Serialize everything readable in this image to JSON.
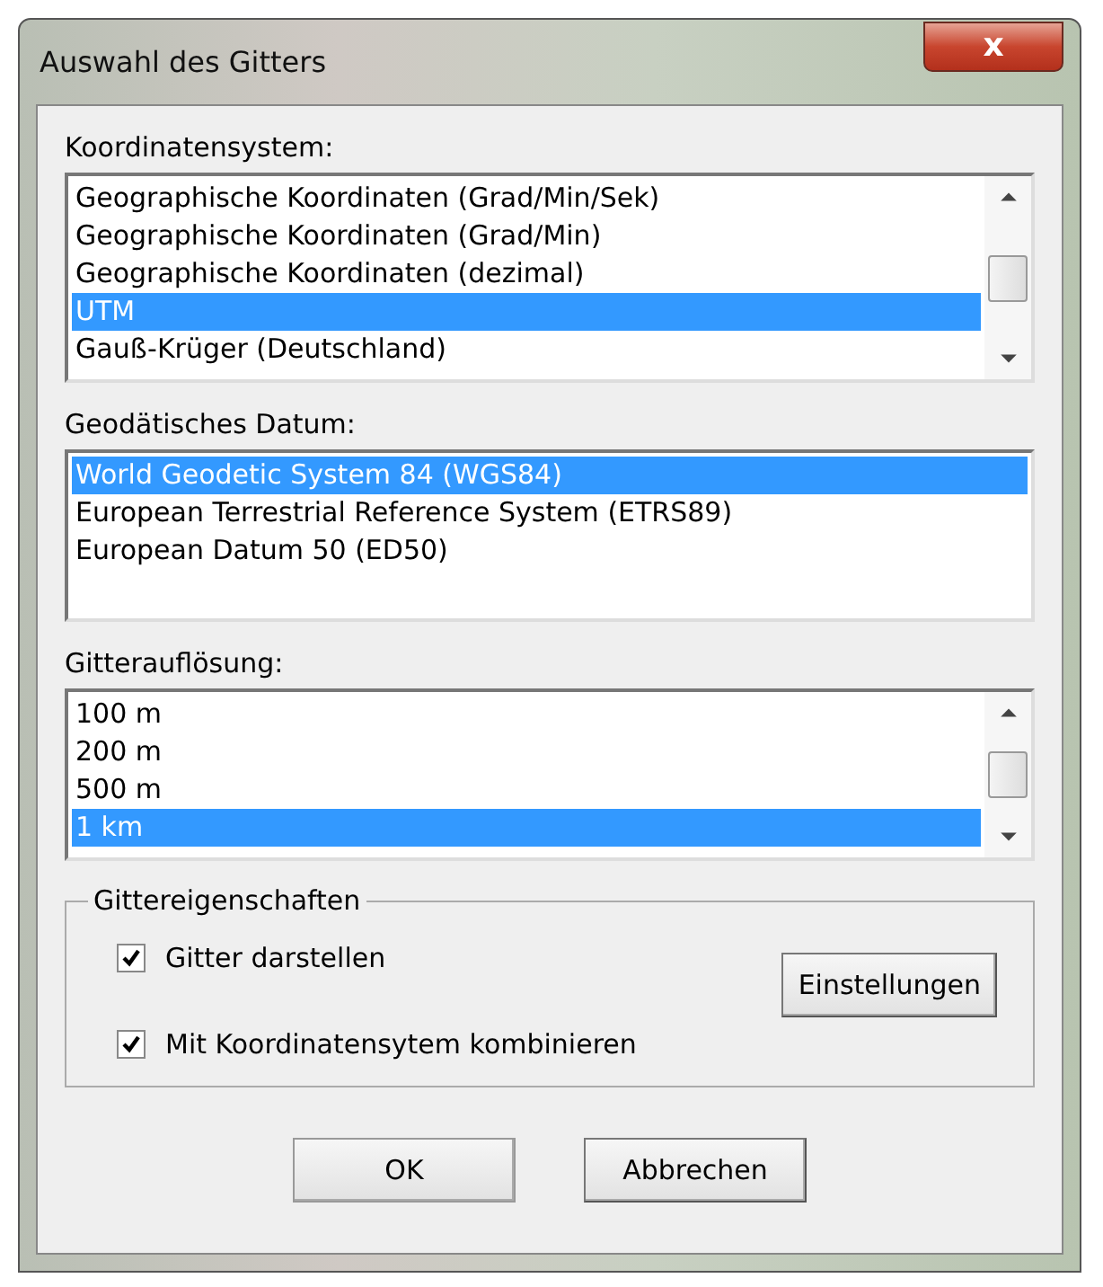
{
  "window": {
    "title": "Auswahl des Gitters",
    "close_label": "x"
  },
  "lists": [
    {
      "label": "Koordinatensystem:",
      "scrollbar": true,
      "items": [
        {
          "text": "Geographische Koordinaten (Grad/Min/Sek)",
          "selected": false
        },
        {
          "text": "Geographische Koordinaten (Grad/Min)",
          "selected": false
        },
        {
          "text": "Geographische Koordinaten (dezimal)",
          "selected": false
        },
        {
          "text": "UTM",
          "selected": true
        },
        {
          "text": "Gauß-Krüger (Deutschland)",
          "selected": false
        }
      ]
    },
    {
      "label": "Geodätisches Datum:",
      "scrollbar": false,
      "items": [
        {
          "text": "World Geodetic System 84 (WGS84)",
          "selected": true
        },
        {
          "text": "European Terrestrial Reference System (ETRS89)",
          "selected": false
        },
        {
          "text": "European Datum 50 (ED50)",
          "selected": false
        }
      ]
    },
    {
      "label": "Gitterauflösung:",
      "scrollbar": true,
      "items": [
        {
          "text": "100 m",
          "selected": false
        },
        {
          "text": "200 m",
          "selected": false
        },
        {
          "text": "500 m",
          "selected": false
        },
        {
          "text": "1 km",
          "selected": true
        }
      ]
    }
  ],
  "group": {
    "title": "Gittereigenschaften",
    "checkboxes": [
      {
        "label": "Gitter darstellen",
        "checked": true
      },
      {
        "label": "Mit Koordinatensytem kombinieren",
        "checked": true
      }
    ],
    "button": "Einstellungen"
  },
  "buttons": [
    {
      "label": "OK",
      "default": true
    },
    {
      "label": "Abbrechen",
      "default": false
    }
  ]
}
